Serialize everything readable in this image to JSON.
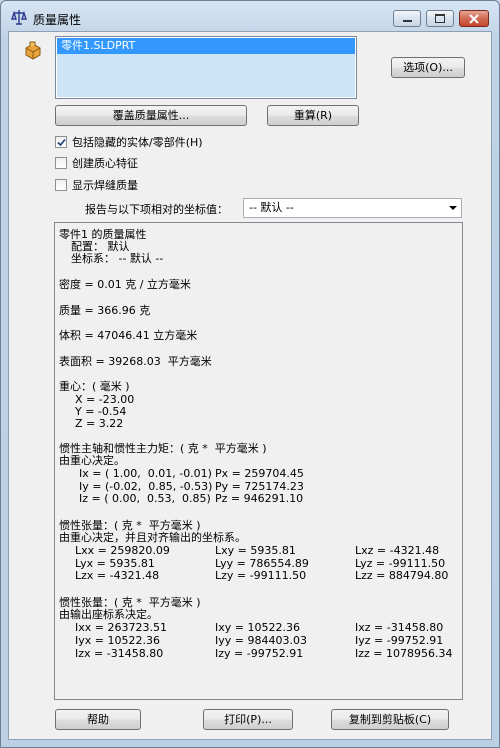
{
  "window": {
    "title": "质量属性"
  },
  "part_list": {
    "selected_item": "零件1.SLDPRT"
  },
  "buttons": {
    "options": "选项(O)...",
    "override": "覆盖质量属性...",
    "recalculate": "重算(R)",
    "help": "帮助",
    "print": "打印(P)...",
    "copy": "复制到剪贴板(C)"
  },
  "checkboxes": [
    {
      "label": "包括隐藏的实体/零部件(H)",
      "checked": true
    },
    {
      "label": "创建质心特征",
      "checked": false
    },
    {
      "label": "显示焊缝质量",
      "checked": false
    }
  ],
  "coord": {
    "label": "报告与以下项相对的坐标值：",
    "value": "-- 默认 --"
  },
  "results": {
    "header": "零件1 的质量属性",
    "config": "配置： 默认",
    "coordsys": "坐标系： -- 默认 --",
    "density": "密度 = 0.01 克 / 立方毫米",
    "mass": "质量 = 366.96 克",
    "volume": "体积 = 47046.41 立方毫米",
    "surface": "表面积 = 39268.03  平方毫米",
    "com_title": "重心：( 毫米 )",
    "com_x": "X = -23.00",
    "com_y": "Y = -0.54",
    "com_z": "Z = 3.22",
    "principal_title": "惯性主轴和惯性主力矩：( 克 *  平方毫米 )",
    "principal_sub": "由重心决定。",
    "ix": "Ix = ( 1.00,  0.01, -0.01)",
    "iy": "Iy = (-0.02,  0.85, -0.53)",
    "iz": "Iz = ( 0.00,  0.53,  0.85)",
    "px": "Px = 259704.45",
    "py": "Py = 725174.23",
    "pz": "Pz = 946291.10",
    "tensor1_title": "惯性张量：( 克 *  平方毫米 )",
    "tensor1_sub": "由重心决定，并且对齐输出的坐标系。",
    "lxx": "Lxx = 259820.09",
    "lxy": "Lxy = 5935.81",
    "lxz": "Lxz = -4321.48",
    "lyx": "Lyx = 5935.81",
    "lyy": "Lyy = 786554.89",
    "lyz": "Lyz = -99111.50",
    "lzx": "Lzx = -4321.48",
    "lzy": "Lzy = -99111.50",
    "lzz": "Lzz = 884794.80",
    "tensor2_title": "惯性张量：( 克 *  平方毫米 )",
    "tensor2_sub": "由输出座标系决定。",
    "ixx": "Ixx = 263723.51",
    "ixy": "Ixy = 10522.36",
    "ixz": "Ixz = -31458.80",
    "iyx": "Iyx = 10522.36",
    "iyy": "Iyy = 984403.03",
    "iyz": "Iyz = -99752.91",
    "izx": "Izx = -31458.80",
    "izy": "Izy = -99752.91",
    "izz": "Izz = 1078956.34"
  }
}
